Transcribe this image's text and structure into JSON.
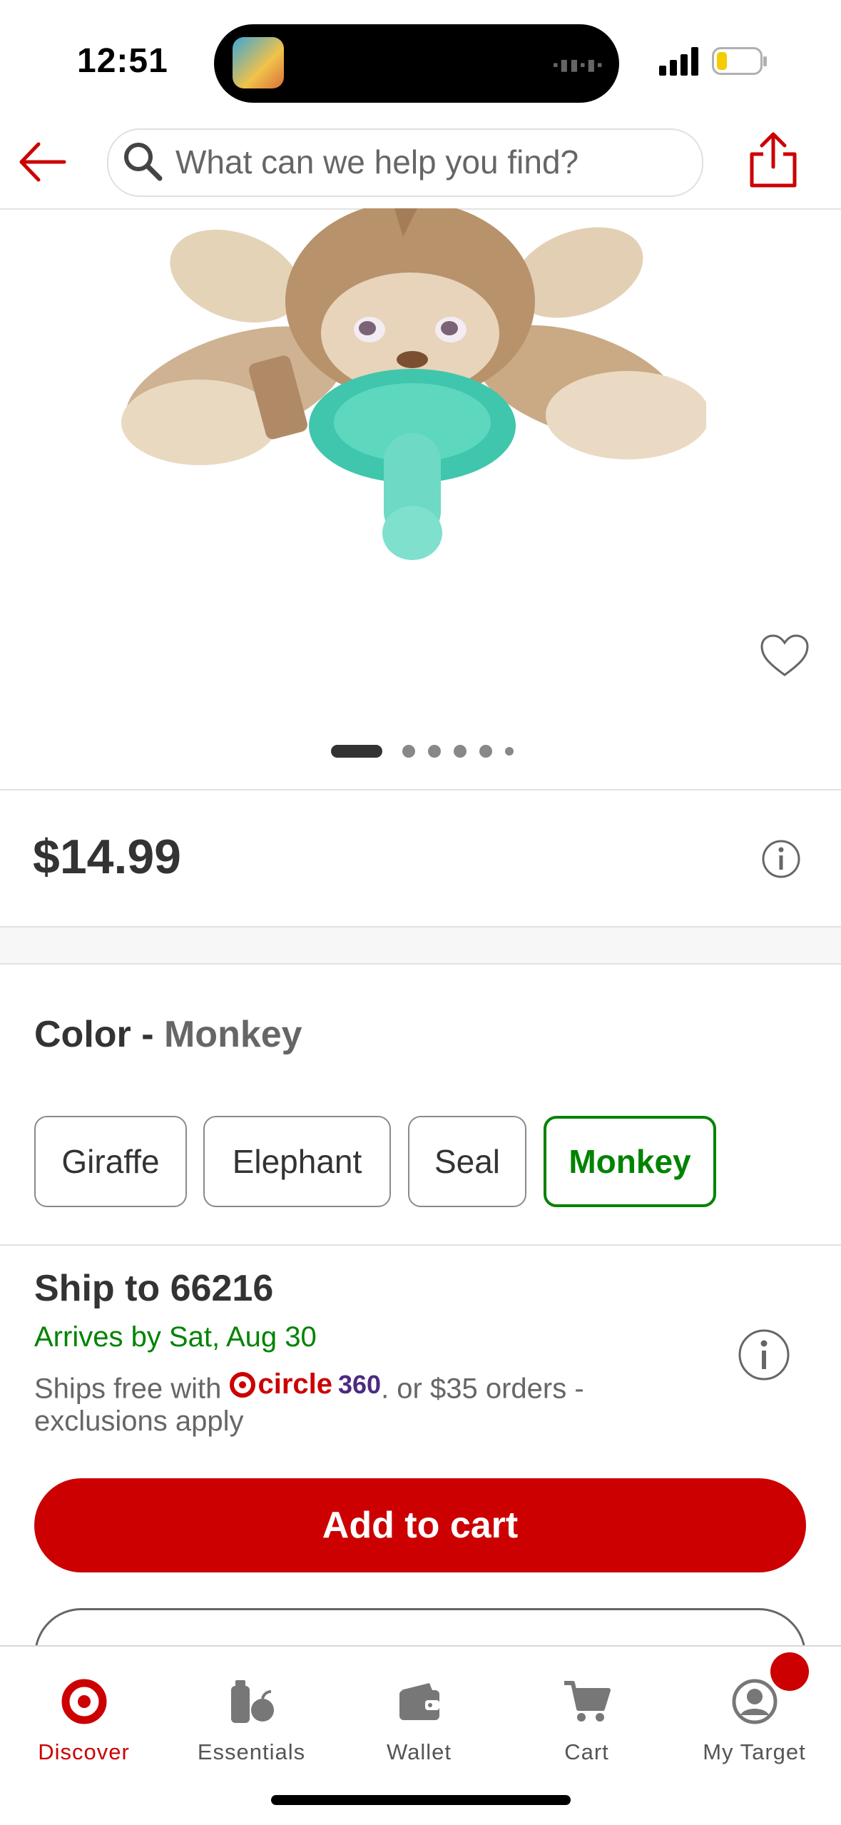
{
  "status_bar": {
    "time": "12:51"
  },
  "header": {
    "search_placeholder": "What can we help you find?"
  },
  "product": {
    "price": "$14.99",
    "carousel": {
      "count": 6,
      "active_index": 0
    }
  },
  "color": {
    "label": "Color",
    "separator": " - ",
    "selected": "Monkey",
    "options": [
      "Giraffe",
      "Elephant",
      "Seal",
      "Monkey"
    ]
  },
  "shipping": {
    "title": "Ship to 66216",
    "arrives": "Arrives by Sat, Aug 30",
    "line1_prefix": "Ships free with ",
    "circle_text": "circle",
    "circle_num": "360",
    "line1_suffix": ". or $35 orders -",
    "line2": "exclusions apply"
  },
  "actions": {
    "add_to_cart": "Add to cart"
  },
  "tabs": [
    {
      "label": "Discover",
      "icon": "target-bullseye-icon",
      "active": true
    },
    {
      "label": "Essentials",
      "icon": "essentials-icon",
      "active": false
    },
    {
      "label": "Wallet",
      "icon": "wallet-icon",
      "active": false
    },
    {
      "label": "Cart",
      "icon": "cart-icon",
      "active": false
    },
    {
      "label": "My Target",
      "icon": "account-icon",
      "active": false
    }
  ],
  "colors": {
    "brand_red": "#cc0000",
    "selected_green": "#008300",
    "circle_purple": "#4d2b7f"
  }
}
